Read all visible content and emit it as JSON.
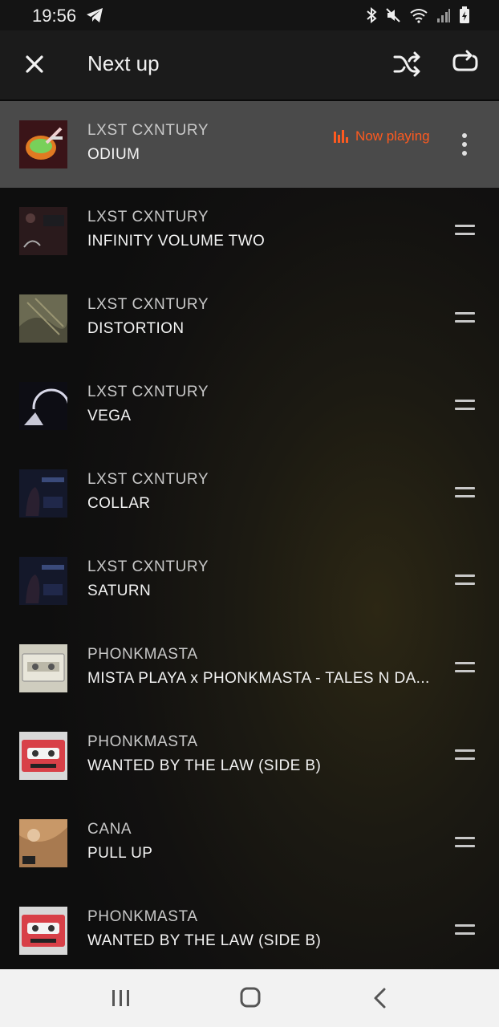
{
  "status_bar": {
    "time": "19:56",
    "icons": [
      "telegram-icon",
      "bluetooth-icon",
      "mute-icon",
      "wifi-icon",
      "signal-icon",
      "battery-icon"
    ]
  },
  "header": {
    "title": "Next up",
    "icons": [
      "close-icon",
      "shuffle-icon",
      "repeat-icon"
    ]
  },
  "now_playing_label": "Now playing",
  "accent_color": "#ff5a1f",
  "queue": [
    {
      "artist": "LXST CXNTURY",
      "title": "ODIUM",
      "now_playing": true
    },
    {
      "artist": "LXST CXNTURY",
      "title": "INFINITY VOLUME TWO"
    },
    {
      "artist": "LXST CXNTURY",
      "title": "DISTORTION"
    },
    {
      "artist": "LXST CXNTURY",
      "title": "VEGA"
    },
    {
      "artist": "LXST CXNTURY",
      "title": "COLLAR"
    },
    {
      "artist": "LXST CXNTURY",
      "title": "SATURN"
    },
    {
      "artist": "PHONKMASTA",
      "title": "MISTA PLAYA x PHONKMASTA - TALES N DA..."
    },
    {
      "artist": "PHONKMASTA",
      "title": "WANTED BY THE LAW (SIDE B)"
    },
    {
      "artist": "CANA",
      "title": "PULL UP"
    },
    {
      "artist": "PHONKMASTA",
      "title": "WANTED BY THE LAW (SIDE B)"
    }
  ],
  "nav_bar": {
    "icons": [
      "recents-icon",
      "home-icon",
      "back-icon"
    ]
  }
}
